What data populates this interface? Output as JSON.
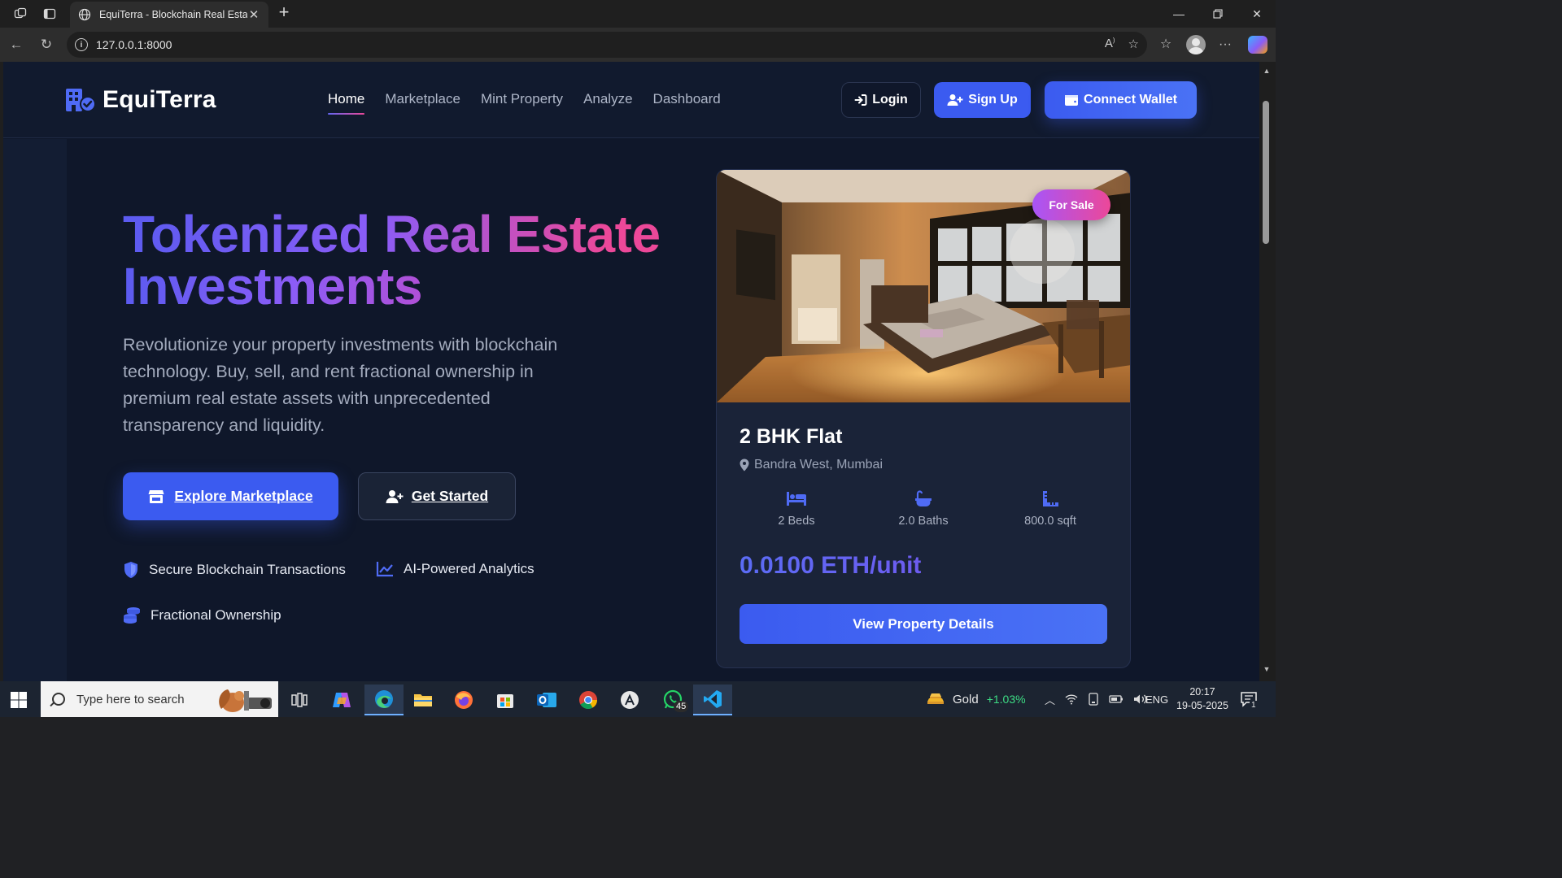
{
  "browser": {
    "tab_title": "EquiTerra - Blockchain Real Estate",
    "new_tab_icon": "plus-icon",
    "url": "127.0.0.1:8000"
  },
  "site": {
    "logo_text": "EquiTerra",
    "nav": [
      {
        "label": "Home",
        "active": true
      },
      {
        "label": "Marketplace",
        "active": false
      },
      {
        "label": "Mint Property",
        "active": false
      },
      {
        "label": "Analyze",
        "active": false
      },
      {
        "label": "Dashboard",
        "active": false
      }
    ],
    "login_label": "Login",
    "signup_label": "Sign Up",
    "wallet_label": "Connect Wallet"
  },
  "hero": {
    "title_line1": "Tokenized Real Estate",
    "title_line2": "Investments",
    "description": "Revolutionize your property investments with blockchain technology. Buy, sell, and rent fractional ownership in premium real estate assets with unprecedented transparency and liquidity.",
    "primary_cta": "Explore Marketplace",
    "secondary_cta": "Get Started",
    "features": [
      {
        "label": "Secure Blockchain Transactions",
        "icon": "shield-icon"
      },
      {
        "label": "AI-Powered Analytics",
        "icon": "chart-line-icon"
      },
      {
        "label": "Fractional Ownership",
        "icon": "coins-icon"
      }
    ]
  },
  "property_card": {
    "badge": "For Sale",
    "title": "2 BHK Flat",
    "location": "Bandra West, Mumbai",
    "specs": [
      {
        "label": "2 Beds",
        "icon": "bed-icon"
      },
      {
        "label": "2.0 Baths",
        "icon": "bath-icon"
      },
      {
        "label": "800.0 sqft",
        "icon": "ruler-icon"
      }
    ],
    "price": "0.0100 ETH/unit",
    "button": "View Property Details"
  },
  "taskbar": {
    "search_placeholder": "Type here to search",
    "whatsapp_badge": "45",
    "ticker_name": "Gold",
    "ticker_change": "+1.03%",
    "language": "ENG",
    "time": "20:17",
    "date": "19-05-2025",
    "notification_count": "1"
  },
  "colors": {
    "accent": "#3b5bf0",
    "background": "#0f172a",
    "card": "#1a2338",
    "badge_gradient": [
      "#a855f7",
      "#ec4899"
    ],
    "positive": "#3ddc84"
  }
}
